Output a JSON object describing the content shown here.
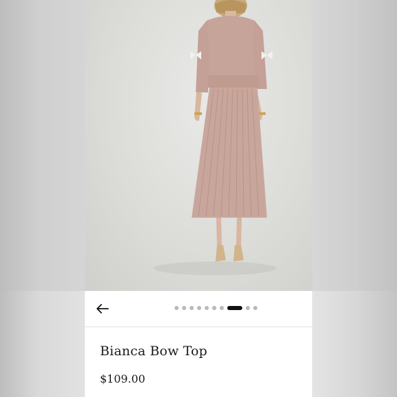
{
  "product": {
    "name": "Bianca Bow Top",
    "price": "$109.00"
  },
  "gallery": {
    "image_count": 11,
    "active_index": 8,
    "image_description_icon": "model-photo"
  },
  "navigation": {
    "back_icon": "back-arrow-icon"
  },
  "colors": {
    "garment": "#c9a69c",
    "background": "#dcdcd9",
    "active_dot": "#111111",
    "inactive_dot": "#b9b9b9"
  }
}
